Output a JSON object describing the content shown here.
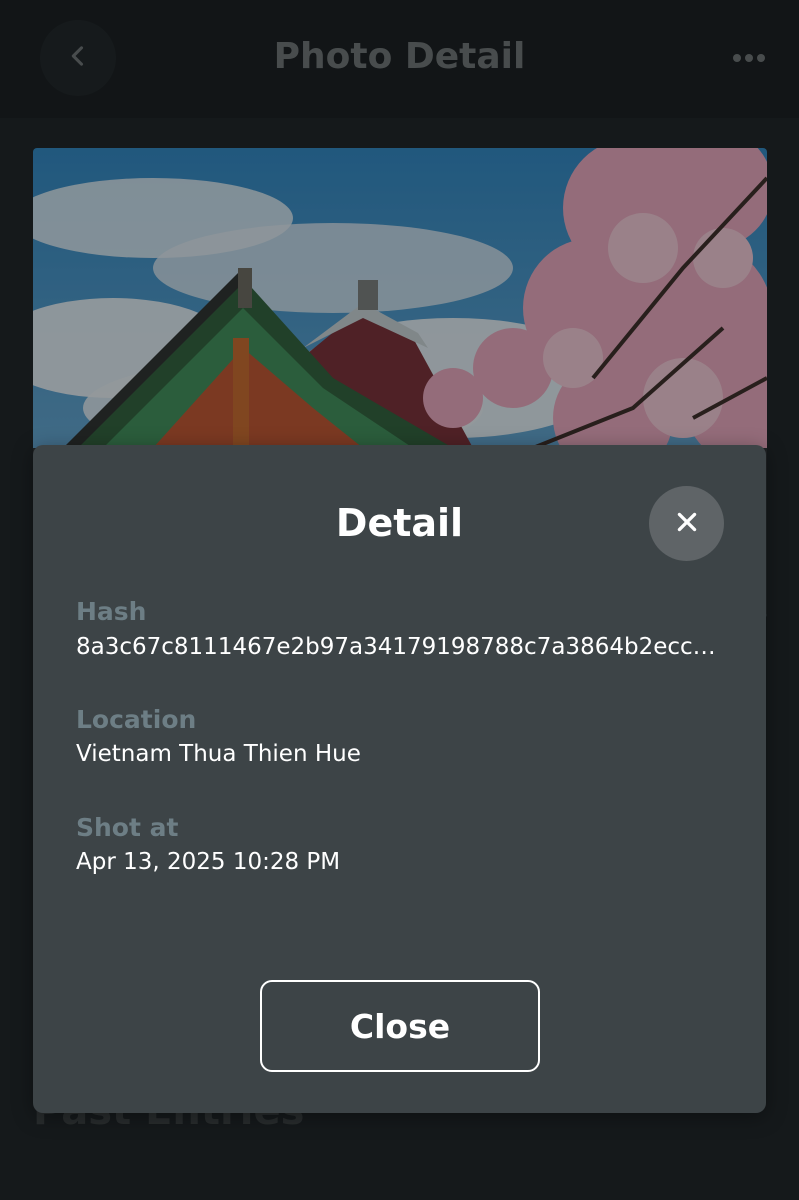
{
  "header": {
    "title": "Photo Detail",
    "back_icon": "chevron-left-icon",
    "more_icon": "more-horizontal-icon"
  },
  "photo": {
    "alt": "Palace roof with cherry blossoms"
  },
  "background": {
    "section_heading": "Past Entries"
  },
  "modal": {
    "title": "Detail",
    "close_icon": "close-icon",
    "fields": [
      {
        "label": "Hash",
        "value": "8a3c67c8111467e2b97a34179198788c7a3864b2ecc9d..."
      },
      {
        "label": "Location",
        "value": "Vietnam Thua Thien Hue"
      },
      {
        "label": "Shot at",
        "value": "Apr 13, 2025 10:28 PM"
      }
    ],
    "close_label": "Close"
  },
  "colors": {
    "background": "#1c2124",
    "modal": "#3d4447",
    "label": "#6d7e85",
    "text": "#ffffff"
  }
}
